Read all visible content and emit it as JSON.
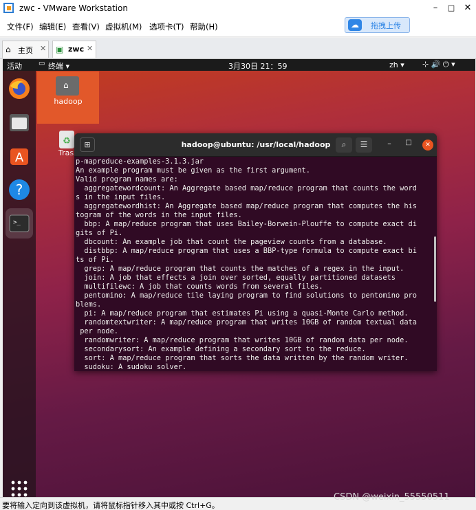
{
  "window": {
    "title": "zwc - VMware Workstation",
    "minimize": "–",
    "maximize": "□",
    "close": "✕"
  },
  "menu": [
    "文件(F)",
    "编辑(E)",
    "查看(V)",
    "虚拟机(M)",
    "选项卡(T)",
    "帮助(H)"
  ],
  "upload": {
    "label": "拖拽上传"
  },
  "tabs": [
    {
      "label": "主页",
      "close": "✕"
    },
    {
      "label": "zwc",
      "close": "✕"
    }
  ],
  "ubuntu_topbar": {
    "activities": "活动",
    "app_menu": "终端 ▾",
    "datetime": "3月30日  21：59",
    "lang": "zh ▾",
    "status_icons": "⊹  🔊  ⏻ ▾"
  },
  "desktop": {
    "folder_label": "hadoop",
    "trash_label": "Tras"
  },
  "terminal": {
    "title": "hadoop@ubuntu: /usr/local/hadoop",
    "lines": [
      "p-mapreduce-examples-3.1.3.jar",
      "An example program must be given as the first argument.",
      "Valid program names are:",
      "  aggregatewordcount: An Aggregate based map/reduce program that counts the word",
      "s in the input files.",
      "  aggregatewordhist: An Aggregate based map/reduce program that computes the his",
      "togram of the words in the input files.",
      "  bbp: A map/reduce program that uses Bailey-Borwein-Plouffe to compute exact di",
      "gits of Pi.",
      "  dbcount: An example job that count the pageview counts from a database.",
      "  distbbp: A map/reduce program that uses a BBP-type formula to compute exact bi",
      "ts of Pi.",
      "  grep: A map/reduce program that counts the matches of a regex in the input.",
      "  join: A job that effects a join over sorted, equally partitioned datasets",
      "  multifilewc: A job that counts words from several files.",
      "  pentomino: A map/reduce tile laying program to find solutions to pentomino pro",
      "blems.",
      "  pi: A map/reduce program that estimates Pi using a quasi-Monte Carlo method.",
      "  randomtextwriter: A map/reduce program that writes 10GB of random textual data",
      " per node.",
      "  randomwriter: A map/reduce program that writes 10GB of random data per node.",
      "  secondarysort: An example defining a secondary sort to the reduce.",
      "  sort: A map/reduce program that sorts the data written by the random writer.",
      "  sudoku: A sudoku solver."
    ]
  },
  "status": {
    "text": "要将输入定向到该虚拟机，请将鼠标指针移入其中或按 Ctrl+G。"
  },
  "watermark": "CSDN @weixin_55550511"
}
